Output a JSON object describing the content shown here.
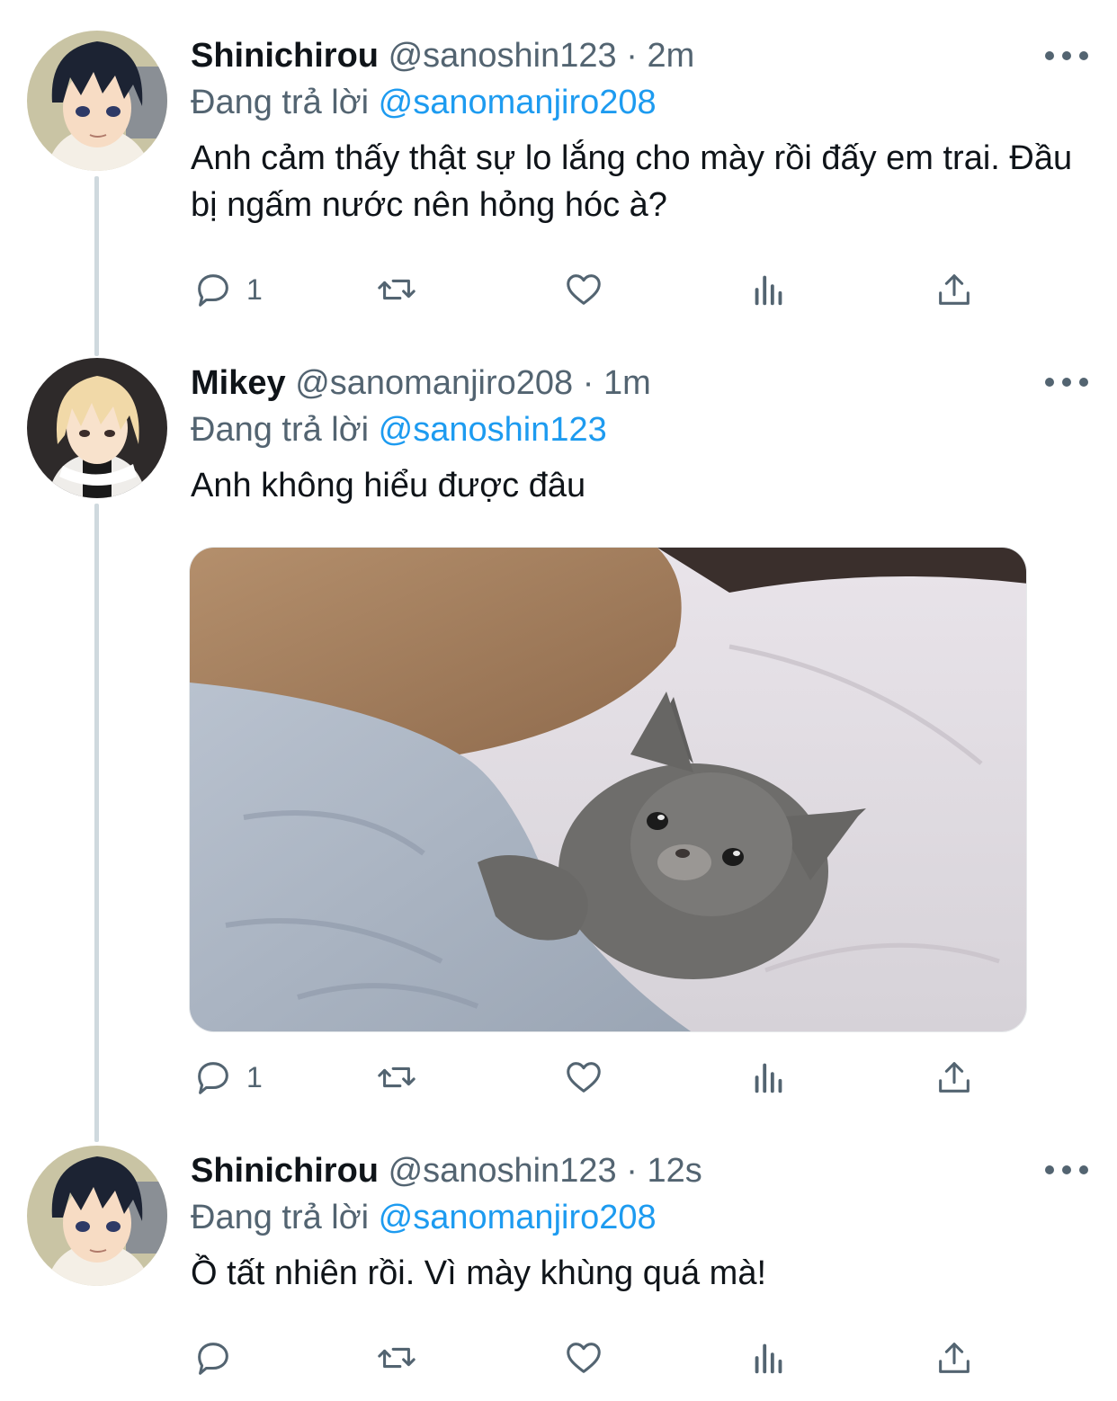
{
  "tweets": [
    {
      "display_name": "Shinichirou",
      "handle": "@sanoshin123",
      "separator": "·",
      "time": "2m",
      "reply_prefix": "Đang trả lời",
      "reply_to": "@sanomanjiro208",
      "text": "Anh cảm thấy thật sự lo lắng cho mày rồi đấy em trai. Đầu bị ngấm nước nên hỏng hóc à?",
      "reply_count": "1"
    },
    {
      "display_name": "Mikey",
      "handle": "@sanomanjiro208",
      "separator": "·",
      "time": "1m",
      "reply_prefix": "Đang trả lời",
      "reply_to": "@sanoshin123",
      "text": "Anh không hiểu được đâu",
      "reply_count": "1"
    },
    {
      "display_name": "Shinichirou",
      "handle": "@sanoshin123",
      "separator": "·",
      "time": "12s",
      "reply_prefix": "Đang trả lời",
      "reply_to": "@sanomanjiro208",
      "text": "Ồ tất nhiên rồi. Vì mày khùng quá mà!",
      "reply_count": ""
    }
  ],
  "icons": {
    "reply": "comment-bubble-icon",
    "retweet": "retweet-icon",
    "like": "heart-icon",
    "views": "bar-chart-icon",
    "share": "share-upload-icon",
    "more": "more-dots-icon"
  },
  "colors": {
    "text": "#0f1419",
    "secondary": "#536471",
    "link": "#1d9bf0",
    "thread_line": "#cfd9de"
  }
}
